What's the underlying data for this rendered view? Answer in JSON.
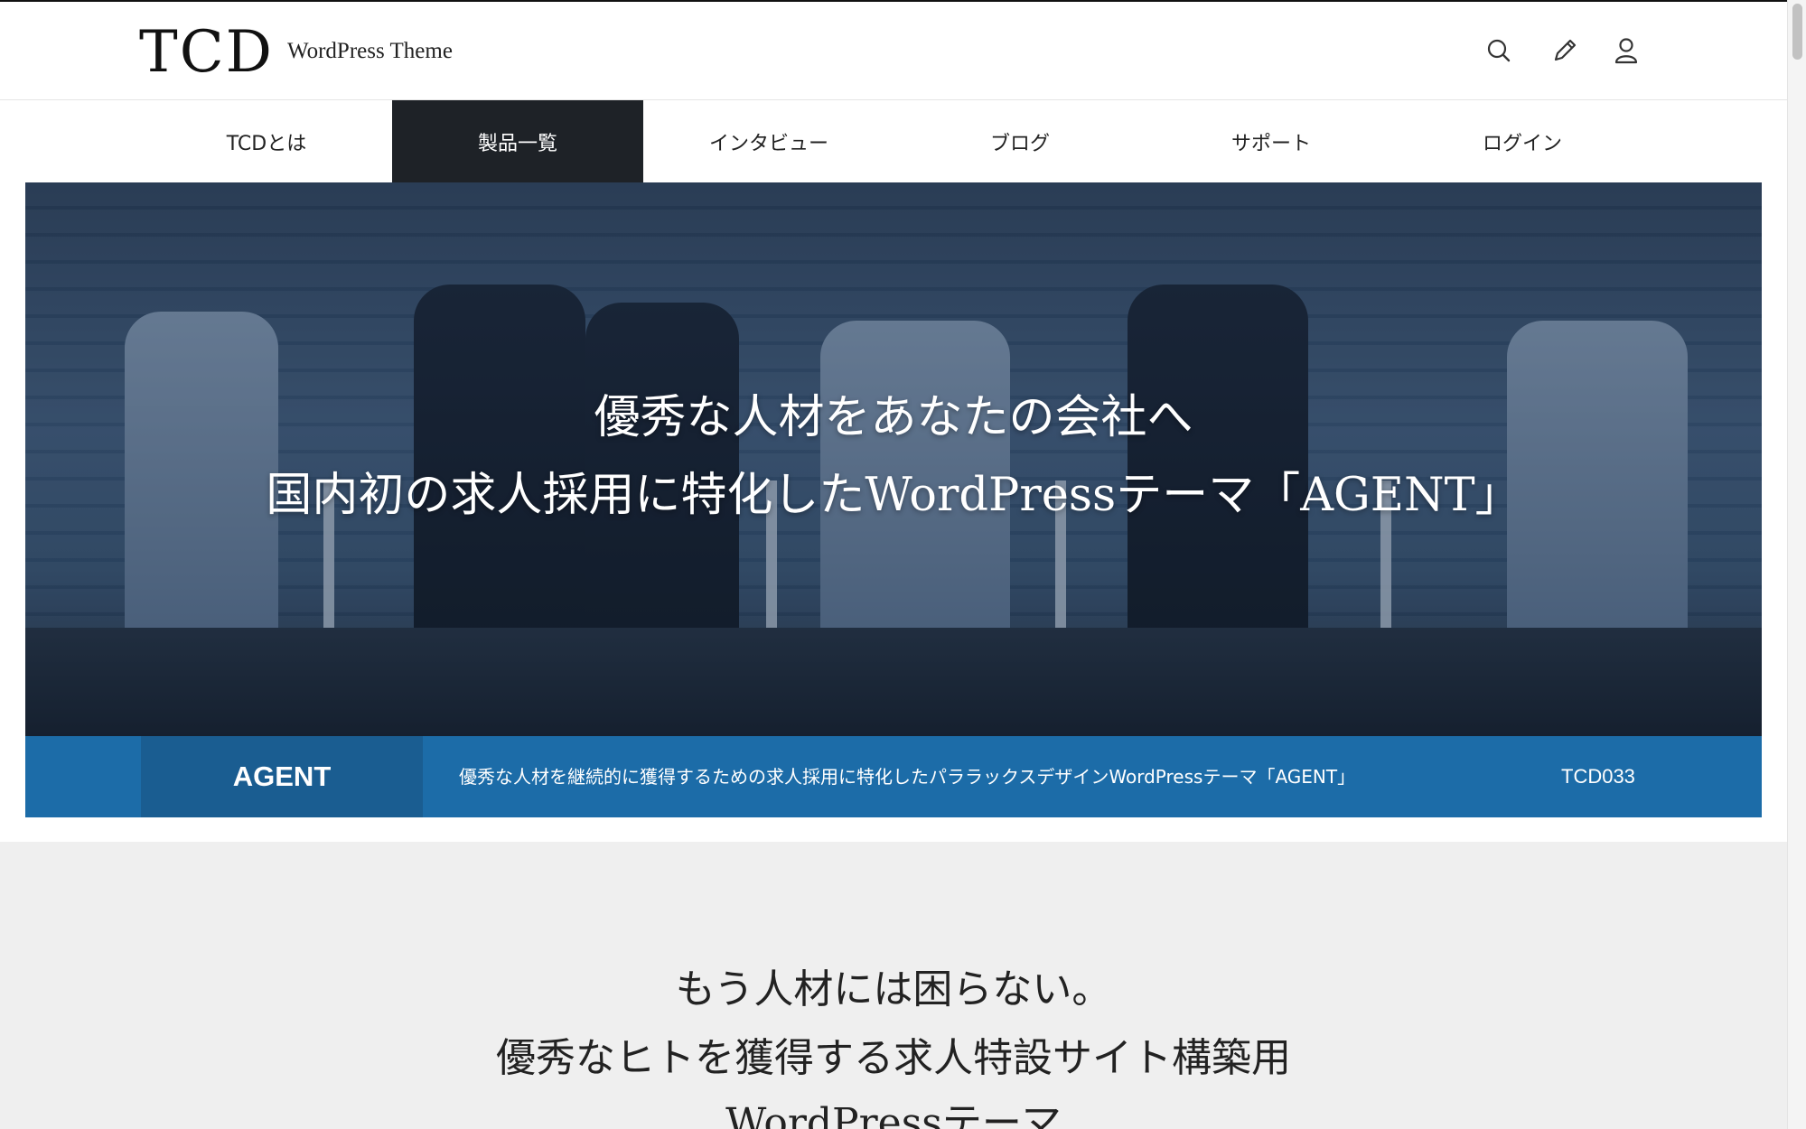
{
  "header": {
    "logo": "TCD",
    "tagline": "WordPress Theme",
    "icons": [
      "search-icon",
      "pencil-icon",
      "user-icon"
    ]
  },
  "nav": {
    "items": [
      {
        "label": "TCDとは"
      },
      {
        "label": "製品一覧",
        "active": true
      },
      {
        "label": "インタビュー"
      },
      {
        "label": "ブログ"
      },
      {
        "label": "サポート"
      },
      {
        "label": "ログイン"
      }
    ]
  },
  "hero": {
    "line1": "優秀な人材をあなたの会社へ",
    "line2": "国内初の求人採用に特化したWordPressテーマ「AGENT」"
  },
  "product": {
    "name": "AGENT",
    "description": "優秀な人材を継続的に獲得するための求人採用に特化したパララックスデザインWordPressテーマ「AGENT」",
    "code": "TCD033"
  },
  "section": {
    "line1": "もう人材には困らない。",
    "line2": "優秀なヒトを獲得する求人特設サイト構築用",
    "line3": "WordPressテーマ"
  },
  "colors": {
    "nav_active_bg": "#1e2227",
    "product_bar": "#1c6ca8",
    "product_name_bg": "#1a5d91",
    "section_bg": "#efefef"
  }
}
